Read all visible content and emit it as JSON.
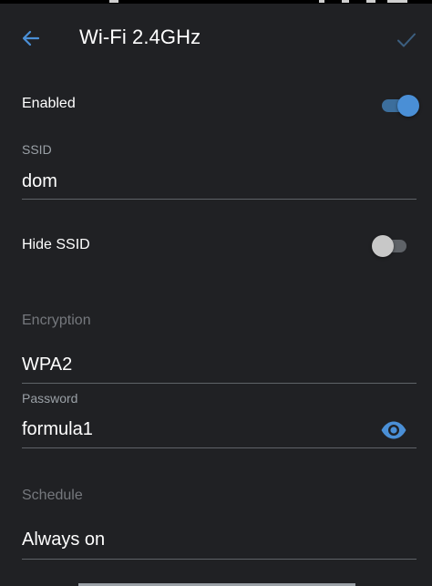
{
  "header": {
    "title": "Wi-Fi 2.4GHz",
    "back_icon": "arrow-left-icon",
    "confirm_icon": "check-icon"
  },
  "enabled": {
    "label": "Enabled",
    "state": true
  },
  "ssid": {
    "label": "SSID",
    "value": "dom"
  },
  "hide_ssid": {
    "label": "Hide SSID",
    "state": false
  },
  "encryption": {
    "section_label": "Encryption",
    "value": "WPA2"
  },
  "password": {
    "label": "Password",
    "value": "formula1",
    "visibility_icon": "eye-icon"
  },
  "schedule": {
    "section_label": "Schedule",
    "value": "Always on"
  },
  "colors": {
    "background": "#202124",
    "accent": "#4a8fd6",
    "text": "#ffffff",
    "muted_text": "#9aa0a6",
    "divider": "#5f6368"
  }
}
